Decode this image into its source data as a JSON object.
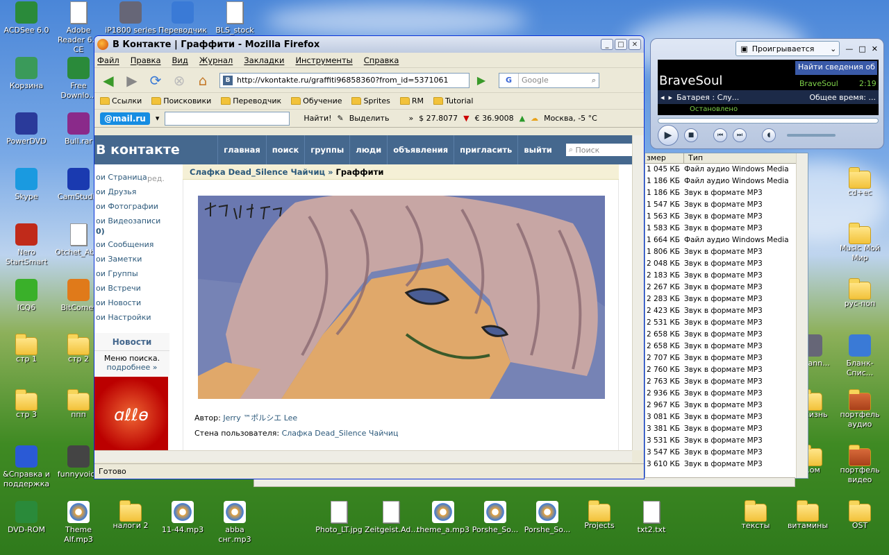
{
  "desktop_icons": [
    {
      "label": "ACDSee 6.0",
      "icon": "acdsee-icon"
    },
    {
      "label": "Adobe Reader 6.0 CE",
      "icon": "pdf-icon"
    },
    {
      "label": "iP1800 series",
      "icon": "printer-icon"
    },
    {
      "label": "Переводчик",
      "icon": "translator-icon"
    },
    {
      "label": "BLS_stock",
      "icon": "excel-icon"
    },
    {
      "label": "Корзина",
      "icon": "recycle-bin-icon"
    },
    {
      "label": "Free Downlo...",
      "icon": "download-icon"
    },
    {
      "label": "PowerDVD",
      "icon": "dvd-icon"
    },
    {
      "label": "Bull.rar",
      "icon": "rar-icon"
    },
    {
      "label": "Skype",
      "icon": "skype-icon"
    },
    {
      "label": "CamStudio",
      "icon": "camstudio-icon"
    },
    {
      "label": "Nero StartSmart",
      "icon": "nero-icon"
    },
    {
      "label": "Otchet_Ab...",
      "icon": "word-icon"
    },
    {
      "label": "ICQ6",
      "icon": "icq-icon"
    },
    {
      "label": "BitComet",
      "icon": "bitcomet-icon"
    },
    {
      "label": "стр 1",
      "icon": "folder-icon"
    },
    {
      "label": "стр 2",
      "icon": "folder-icon"
    },
    {
      "label": "стр 3",
      "icon": "folder-icon"
    },
    {
      "label": "ппп",
      "icon": "folder-icon"
    },
    {
      "label": "&Справка и поддержка",
      "icon": "help-icon"
    },
    {
      "label": "funnyvoice",
      "icon": "mic-icon"
    },
    {
      "label": "DVD-ROM",
      "icon": "dvd-rom-icon"
    },
    {
      "label": "Theme Alf.mp3",
      "icon": "media-icon"
    },
    {
      "label": "налоги 2",
      "icon": "folder-icon"
    },
    {
      "label": "11-44.mp3",
      "icon": "media-icon"
    },
    {
      "label": "abba снг.mp3",
      "icon": "media-icon"
    },
    {
      "label": "Photo_LT.jpg",
      "icon": "image-icon"
    },
    {
      "label": "Zeitgeist.Ad...",
      "icon": "video-icon"
    },
    {
      "label": "theme_a.mp3",
      "icon": "media-icon"
    },
    {
      "label": "Porshe_So...",
      "icon": "media-icon"
    },
    {
      "label": "Porshe_So...",
      "icon": "media-icon"
    },
    {
      "label": "Projects",
      "icon": "folder-icon"
    },
    {
      "label": "txt2.txt",
      "icon": "text-icon"
    },
    {
      "label": "тексты",
      "icon": "folder-icon"
    },
    {
      "label": "витамины",
      "icon": "folder-icon"
    },
    {
      "label": "OST",
      "icon": "folder-icon"
    },
    {
      "label": "cd+ec",
      "icon": "folder-icon"
    },
    {
      "label": "Music Мой Мир",
      "icon": "folder-icon"
    },
    {
      "label": "рус-поп",
      "icon": "folder-icon"
    },
    {
      "label": "Бланк-Спис...",
      "icon": "paint-icon"
    },
    {
      "label": "портфель аудио",
      "icon": "briefcase-icon"
    },
    {
      "label": "портфель видео",
      "icon": "briefcase-icon"
    },
    {
      "label": "...scann...",
      "icon": "scanner-icon"
    },
    {
      "label": "...жизнь",
      "icon": "folder-icon"
    },
    {
      "label": "...ом",
      "icon": "folder-icon"
    }
  ],
  "browser": {
    "title": "В Контакте | Граффити - Mozilla Firefox",
    "menu": [
      "Файл",
      "Правка",
      "Вид",
      "Журнал",
      "Закладки",
      "Инструменты",
      "Справка"
    ],
    "url": "http://vkontakte.ru/graffiti96858360?from_id=5371061",
    "search_placeholder": "Google",
    "bookmarks": [
      "Ссылки",
      "Поисковики",
      "Переводчик",
      "Обучение",
      "Sprites",
      "RM",
      "Tutorial"
    ],
    "mail_logo": "@mail.ru",
    "find_label": "Найти!",
    "highlight_label": "Выделить",
    "usd": "$ 27.8077",
    "eur": "€ 36.9008",
    "weather": "Москва, -5 °C",
    "status": "Готово"
  },
  "vk": {
    "logo": "В контакте",
    "nav": [
      "главная",
      "поиск",
      "группы",
      "люди",
      "объявления",
      "пригласить",
      "выйти"
    ],
    "search_placeholder": "Поиск",
    "left_menu": [
      "ои Страница",
      "ои Друзья",
      "ои Фотографии",
      "ои Видеозаписи",
      "0)",
      "ои Сообщения",
      "ои Заметки",
      "ои Группы",
      "ои Встречи",
      "ои Новости",
      "ои Настройки"
    ],
    "edit_label": "ред.",
    "news_title": "Новости",
    "news_text": "Меню поиска.",
    "news_more": "подробнее »",
    "breadcrumb_link": "Слафка Dead_Silence Чайчиц",
    "breadcrumb_current": "Граффити",
    "graffiti_signature": "ポルシエ",
    "author_label": "Автор:",
    "author_name": "Jerry ™ポルシエ Lee",
    "wall_label": "Стена пользователя:",
    "wall_name": "Слафка Dead_Silence Чайчиц"
  },
  "wmp": {
    "dropdown": "Проигрывается",
    "artist": "BraveSoul",
    "info_link": "Найти сведения об а...",
    "track_name": "BraveSoul",
    "time": "2:19",
    "now_line": "Батарея : Слу...",
    "total_label": "Общее время: ...",
    "status": "Остановлено"
  },
  "explorer": {
    "headers": [
      "змер",
      "Тип"
    ],
    "rows": [
      {
        "size": "1 045 КБ",
        "type": "Файл аудио Windows Media"
      },
      {
        "size": "1 186 КБ",
        "type": "Файл аудио Windows Media"
      },
      {
        "size": "1 186 КБ",
        "type": "Звук в формате MP3"
      },
      {
        "size": "1 547 КБ",
        "type": "Звук в формате MP3"
      },
      {
        "size": "1 563 КБ",
        "type": "Звук в формате MP3"
      },
      {
        "size": "1 583 КБ",
        "type": "Звук в формате MP3"
      },
      {
        "size": "1 664 КБ",
        "type": "Файл аудио Windows Media"
      },
      {
        "size": "1 806 КБ",
        "type": "Звук в формате MP3"
      },
      {
        "size": "2 048 КБ",
        "type": "Звук в формате MP3"
      },
      {
        "size": "2 183 КБ",
        "type": "Звук в формате MP3"
      },
      {
        "size": "2 267 КБ",
        "type": "Звук в формате MP3"
      },
      {
        "size": "2 283 КБ",
        "type": "Звук в формате MP3"
      },
      {
        "size": "2 423 КБ",
        "type": "Звук в формате MP3"
      },
      {
        "size": "2 531 КБ",
        "type": "Звук в формате MP3"
      },
      {
        "size": "2 658 КБ",
        "type": "Звук в формате MP3"
      },
      {
        "size": "2 658 КБ",
        "type": "Звук в формате MP3"
      },
      {
        "size": "2 707 КБ",
        "type": "Звук в формате MP3"
      },
      {
        "size": "2 760 КБ",
        "type": "Звук в формате MP3"
      },
      {
        "size": "2 763 КБ",
        "type": "Звук в формате MP3"
      },
      {
        "size": "2 936 КБ",
        "type": "Звук в формате MP3"
      },
      {
        "size": "2 967 КБ",
        "type": "Звук в формате MP3"
      },
      {
        "size": "3 081 КБ",
        "type": "Звук в формате MP3"
      },
      {
        "size": "3 381 КБ",
        "type": "Звук в формате MP3"
      },
      {
        "size": "3 531 КБ",
        "type": "Звук в формате MP3"
      },
      {
        "size": "3 547 КБ",
        "type": "Звук в формате MP3"
      },
      {
        "size": "3 610 КБ",
        "type": "Звук в формате MP3"
      }
    ]
  }
}
